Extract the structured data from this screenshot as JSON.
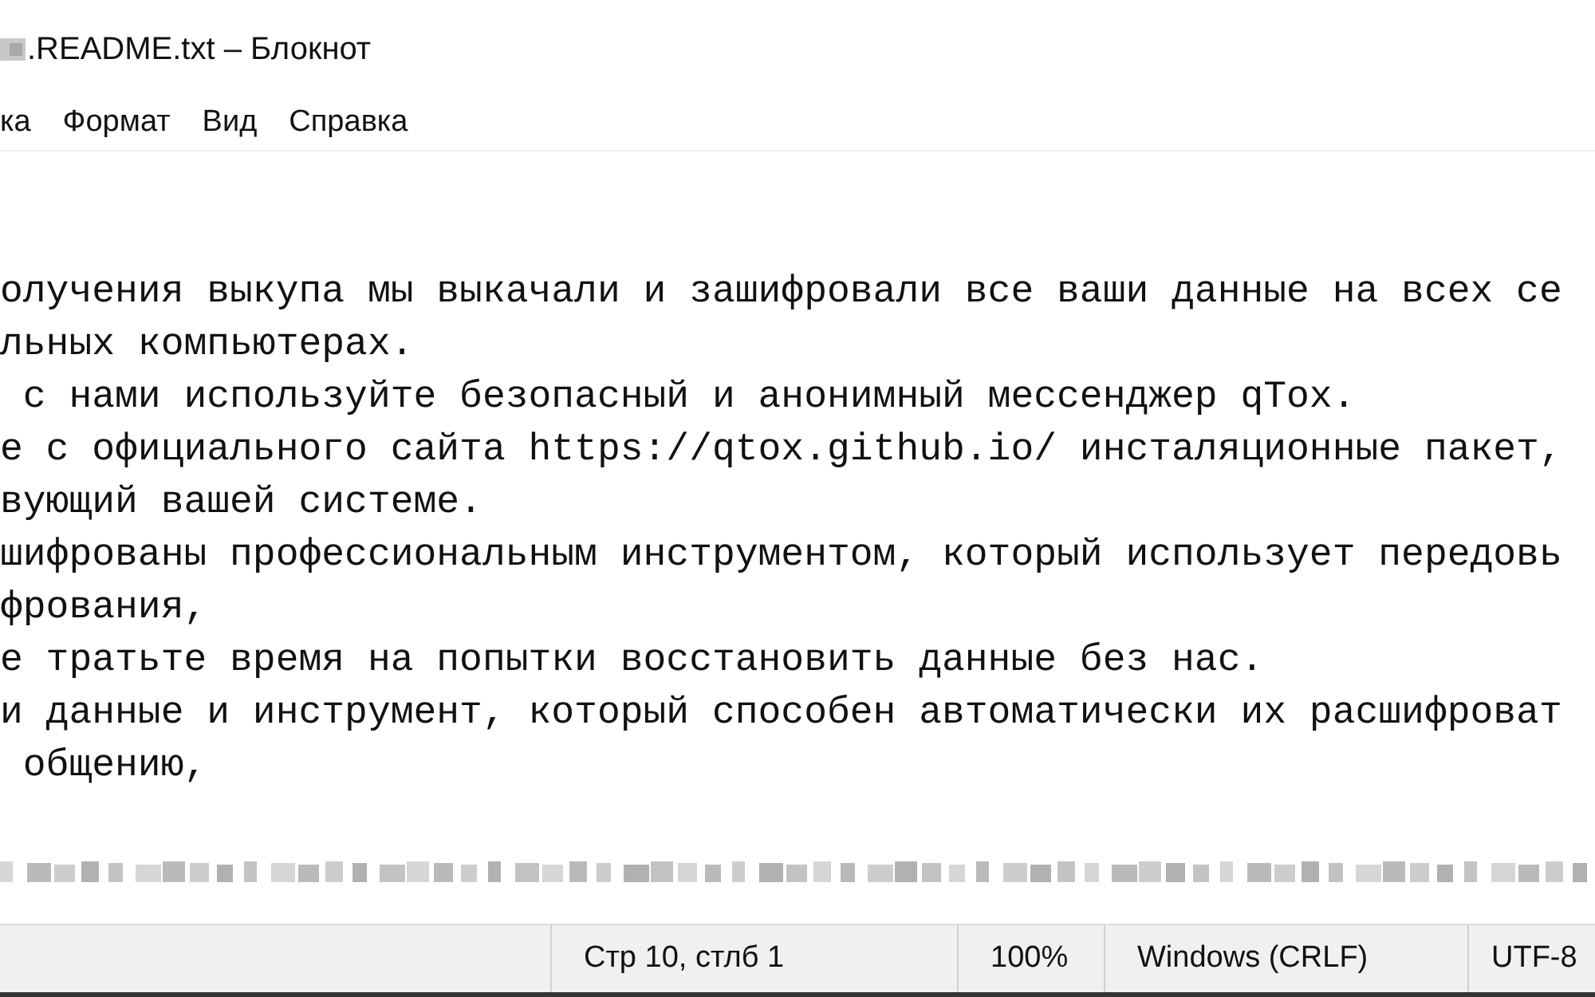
{
  "window": {
    "title": ".README.txt – Блокнот"
  },
  "menu": [
    {
      "label": "ка"
    },
    {
      "label": "Формат"
    },
    {
      "label": "Вид"
    },
    {
      "label": "Справка"
    }
  ],
  "editor": {
    "lines": [
      "олучения выкупа мы выкачали и зашифровали все ваши данные на всех се",
      "льных компьютерах.",
      " с нами используйте безопасный и анонимный мессенджер qTox.",
      "е с официального сайта https://qtox.github.io/ инсталяционные пакет,",
      "вующий вашей системе.",
      "шифрованы профессиональным инструментом, который использует передовь",
      "фрования,",
      "е тратьте время на попытки восстановить данные без нас.",
      "и данные и инструмент, который способен автоматически их расшифроват",
      " общению,"
    ]
  },
  "status_bar": [
    "Стр 10, стлб 1",
    "100%",
    "Windows (CRLF)",
    "UTF-8"
  ]
}
